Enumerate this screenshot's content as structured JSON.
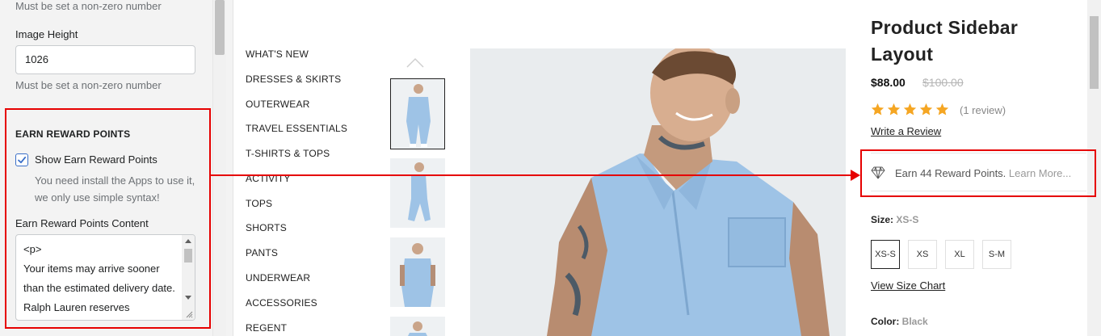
{
  "settings": {
    "top_hint": "Must be set a non-zero number",
    "image_height": {
      "label": "Image Height",
      "value": "1026",
      "hint": "Must be set a non-zero number"
    },
    "reward_section": {
      "title": "EARN REWARD POINTS",
      "checkbox_label": "Show Earn Reward Points",
      "checkbox_checked": true,
      "checkbox_help": "You need install the Apps to use it, we only use simple syntax!",
      "content_label": "Earn Reward Points Content",
      "content_value": "<p>\nYour items may arrive sooner than the estimated delivery date. Ralph Lauren reserves"
    }
  },
  "store": {
    "menu": [
      "WHAT'S NEW",
      "DRESSES & SKIRTS",
      "OUTERWEAR",
      "TRAVEL ESSENTIALS",
      "T-SHIRTS & TOPS",
      "ACTIVITY",
      "TOPS",
      "SHORTS",
      "PANTS",
      "UNDERWEAR",
      "ACCESSORIES",
      "REGENT"
    ],
    "product": {
      "title": "Product Sidebar Layout",
      "price": "$88.00",
      "compare_price": "$100.00",
      "rating": 5,
      "review_count": "(1 review)",
      "write_review": "Write a Review",
      "reward_text": "Earn 44 Reward Points.",
      "reward_link": "Learn More...",
      "size_label": "Size:",
      "size_value": "XS-S",
      "sizes": [
        "XS-S",
        "XS",
        "XL",
        "S-M"
      ],
      "size_chart": "View Size Chart",
      "color_label": "Color:",
      "color_value": "Black"
    }
  },
  "colors": {
    "highlight_red": "#e60000",
    "star_orange": "#f5a623",
    "jumpsuit_blue": "#9ec3e6"
  }
}
